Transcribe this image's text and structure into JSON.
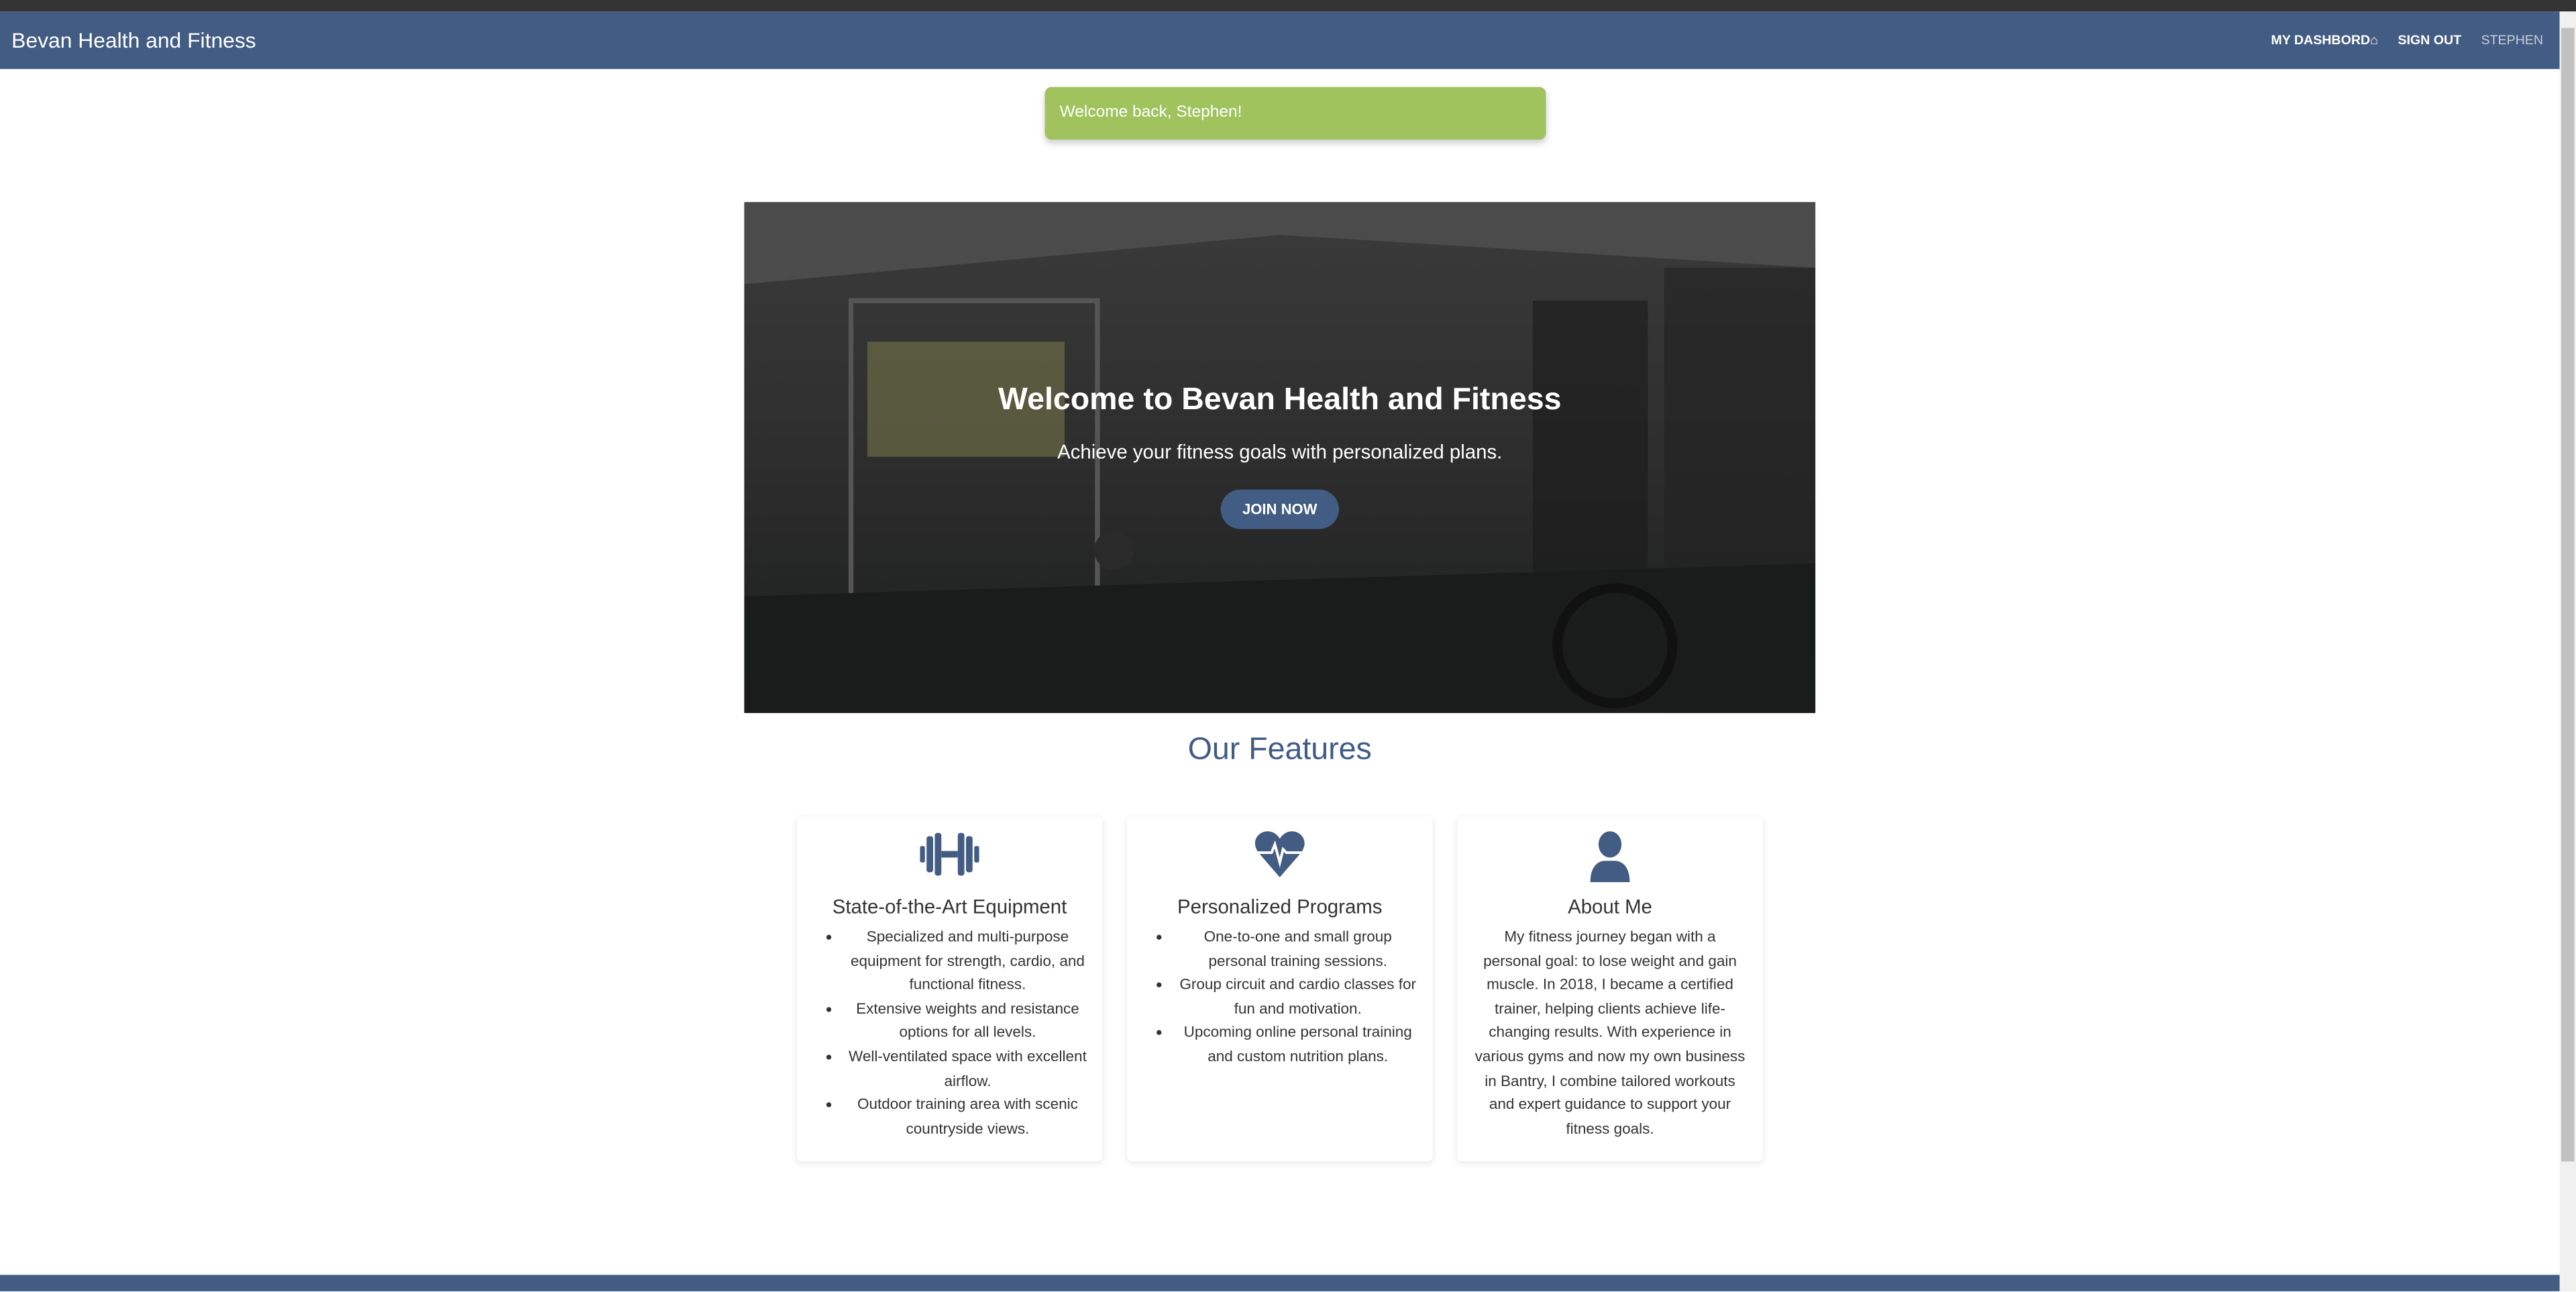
{
  "nav": {
    "brand": "Bevan Health and Fitness",
    "dashboard": "MY DASHBORD",
    "sign_out": "SIGN OUT",
    "user": "STEPHEN"
  },
  "alert": {
    "message": "Welcome back, Stephen!"
  },
  "hero": {
    "title": "Welcome to Bevan Health and Fitness",
    "subtitle": "Achieve your fitness goals with personalized plans.",
    "cta": "JOIN NOW"
  },
  "features": {
    "title": "Our Features",
    "cards": [
      {
        "icon": "dumbbell-icon",
        "title": "State-of-the-Art Equipment",
        "items": [
          "Specialized and multi-purpose equipment for strength, cardio, and functional fitness.",
          "Extensive weights and resistance options for all levels.",
          "Well-ventilated space with excellent airflow.",
          "Outdoor training area with scenic countryside views."
        ]
      },
      {
        "icon": "heartbeat-icon",
        "title": "Personalized Programs",
        "items": [
          "One-to-one and small group personal training sessions.",
          "Group circuit and cardio classes for fun and motivation.",
          "Upcoming online personal training and custom nutrition plans."
        ]
      },
      {
        "icon": "user-icon",
        "title": "About Me",
        "text": "My fitness journey began with a personal goal: to lose weight and gain muscle. In 2018, I became a certified trainer, helping clients achieve life-changing results. With experience in various gyms and now my own business in Bantry, I combine tailored workouts and expert guidance to support your fitness goals."
      }
    ]
  },
  "colors": {
    "primary": "#435c83",
    "alert": "#a0c35e"
  }
}
